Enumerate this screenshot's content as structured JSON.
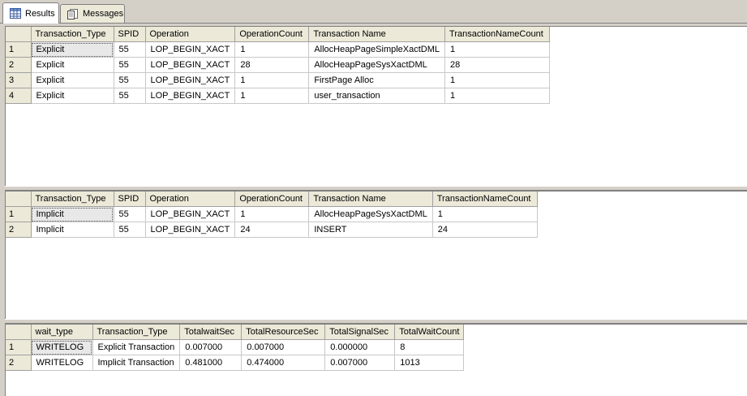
{
  "tabs": [
    {
      "label": "Results",
      "icon": "grid-icon"
    },
    {
      "label": "Messages",
      "icon": "messages-icon"
    }
  ],
  "grids": [
    {
      "columns": [
        "Transaction_Type",
        "SPID",
        "Operation",
        "OperationCount",
        "Transaction Name",
        "TransactionNameCount"
      ],
      "rows": [
        {
          "num": "1",
          "cells": [
            "Explicit",
            "55",
            "LOP_BEGIN_XACT",
            "1",
            "AllocHeapPageSimpleXactDML",
            "1"
          ]
        },
        {
          "num": "2",
          "cells": [
            "Explicit",
            "55",
            "LOP_BEGIN_XACT",
            "28",
            "AllocHeapPageSysXactDML",
            "28"
          ]
        },
        {
          "num": "3",
          "cells": [
            "Explicit",
            "55",
            "LOP_BEGIN_XACT",
            "1",
            "FirstPage Alloc",
            "1"
          ]
        },
        {
          "num": "4",
          "cells": [
            "Explicit",
            "55",
            "LOP_BEGIN_XACT",
            "1",
            "user_transaction",
            "1"
          ]
        }
      ]
    },
    {
      "columns": [
        "Transaction_Type",
        "SPID",
        "Operation",
        "OperationCount",
        "Transaction Name",
        "TransactionNameCount"
      ],
      "rows": [
        {
          "num": "1",
          "cells": [
            "Implicit",
            "55",
            "LOP_BEGIN_XACT",
            "1",
            "AllocHeapPageSysXactDML",
            "1"
          ]
        },
        {
          "num": "2",
          "cells": [
            "Implicit",
            "55",
            "LOP_BEGIN_XACT",
            "24",
            "INSERT",
            "24"
          ]
        }
      ]
    },
    {
      "columns": [
        "wait_type",
        "Transaction_Type",
        "TotalwaitSec",
        "TotalResourceSec",
        "TotalSignalSec",
        "TotalWaitCount"
      ],
      "rows": [
        {
          "num": "1",
          "cells": [
            "WRITELOG",
            "Explicit Transaction",
            "0.007000",
            "0.007000",
            "0.000000",
            "8"
          ]
        },
        {
          "num": "2",
          "cells": [
            "WRITELOG",
            "Implicit Transaction",
            "0.481000",
            "0.474000",
            "0.007000",
            "1013"
          ]
        }
      ]
    }
  ]
}
